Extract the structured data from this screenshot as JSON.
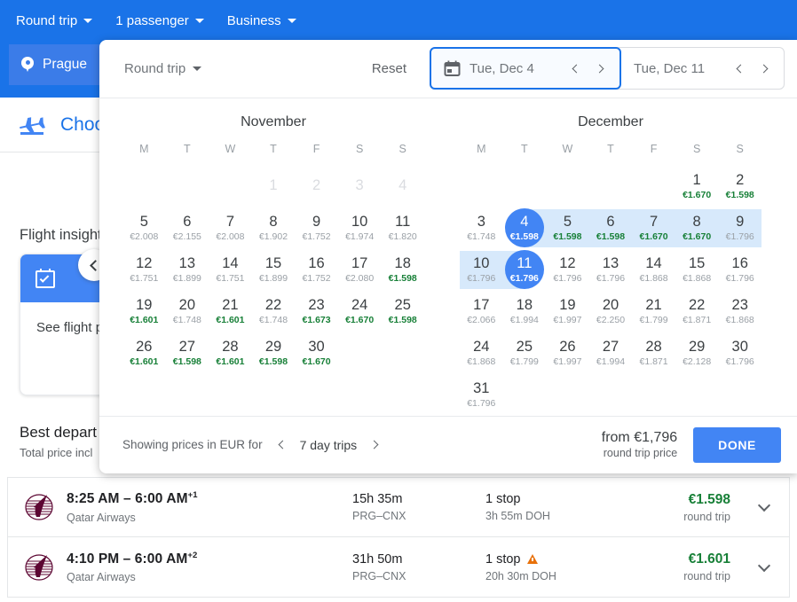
{
  "topbar": {
    "controls": [
      {
        "label": "Round trip",
        "name": "trip-type-dropdown"
      },
      {
        "label": "1 passenger",
        "name": "passengers-dropdown"
      },
      {
        "label": "Business",
        "name": "cabin-class-dropdown"
      }
    ],
    "origin": "Prague"
  },
  "background": {
    "choose_label": "Choose",
    "insights_title": "Flight insights",
    "insight_card_text": "See flight pri",
    "insight_link": "S",
    "best_title": "Best depart",
    "best_subtitle": "Total price incl"
  },
  "dialog": {
    "trip_type": "Round trip",
    "reset_label": "Reset",
    "departure": {
      "value": "Tue, Dec 4"
    },
    "return": {
      "value": "Tue, Dec 11"
    },
    "footer": {
      "showing_prices": "Showing prices in EUR for",
      "trip_length": "7 day trips",
      "from_price": "from €1,796",
      "from_price_sub": "round trip price",
      "done_label": "DONE"
    },
    "dow": [
      "M",
      "T",
      "W",
      "T",
      "F",
      "S",
      "S"
    ],
    "months": [
      {
        "name": "November",
        "lead_blanks": 3,
        "days": [
          {
            "d": 1,
            "price": "",
            "state": "disabled"
          },
          {
            "d": 2,
            "price": "",
            "state": "disabled"
          },
          {
            "d": 3,
            "price": "",
            "state": "disabled"
          },
          {
            "d": 4,
            "price": "",
            "state": "disabled"
          },
          {
            "d": 5,
            "price": "€2.008",
            "state": ""
          },
          {
            "d": 6,
            "price": "€2.155",
            "state": ""
          },
          {
            "d": 7,
            "price": "€2.008",
            "state": ""
          },
          {
            "d": 8,
            "price": "€1.902",
            "state": ""
          },
          {
            "d": 9,
            "price": "€1.752",
            "state": ""
          },
          {
            "d": 10,
            "price": "€1.974",
            "state": ""
          },
          {
            "d": 11,
            "price": "€1.820",
            "state": ""
          },
          {
            "d": 12,
            "price": "€1.751",
            "state": ""
          },
          {
            "d": 13,
            "price": "€1.899",
            "state": ""
          },
          {
            "d": 14,
            "price": "€1.751",
            "state": ""
          },
          {
            "d": 15,
            "price": "€1.899",
            "state": ""
          },
          {
            "d": 16,
            "price": "€1.752",
            "state": ""
          },
          {
            "d": 17,
            "price": "€2.080",
            "state": ""
          },
          {
            "d": 18,
            "price": "€1.598",
            "state": "cheap"
          },
          {
            "d": 19,
            "price": "€1.601",
            "state": "cheap"
          },
          {
            "d": 20,
            "price": "€1.748",
            "state": ""
          },
          {
            "d": 21,
            "price": "€1.601",
            "state": "cheap"
          },
          {
            "d": 22,
            "price": "€1.748",
            "state": ""
          },
          {
            "d": 23,
            "price": "€1.673",
            "state": "cheap"
          },
          {
            "d": 24,
            "price": "€1.670",
            "state": "cheap"
          },
          {
            "d": 25,
            "price": "€1.598",
            "state": "cheap"
          },
          {
            "d": 26,
            "price": "€1.601",
            "state": "cheap"
          },
          {
            "d": 27,
            "price": "€1.598",
            "state": "cheap"
          },
          {
            "d": 28,
            "price": "€1.601",
            "state": "cheap"
          },
          {
            "d": 29,
            "price": "€1.598",
            "state": "cheap"
          },
          {
            "d": 30,
            "price": "€1.670",
            "state": "cheap"
          }
        ]
      },
      {
        "name": "December",
        "lead_blanks": 5,
        "days": [
          {
            "d": 1,
            "price": "€1.670",
            "state": "cheap"
          },
          {
            "d": 2,
            "price": "€1.598",
            "state": "cheap"
          },
          {
            "d": 3,
            "price": "€1.748",
            "state": ""
          },
          {
            "d": 4,
            "price": "€1.598",
            "state": "selected range-start"
          },
          {
            "d": 5,
            "price": "€1.598",
            "state": "cheap inrange"
          },
          {
            "d": 6,
            "price": "€1.598",
            "state": "cheap inrange"
          },
          {
            "d": 7,
            "price": "€1.670",
            "state": "cheap inrange"
          },
          {
            "d": 8,
            "price": "€1.670",
            "state": "cheap inrange"
          },
          {
            "d": 9,
            "price": "€1.796",
            "state": "inrange"
          },
          {
            "d": 10,
            "price": "€1.796",
            "state": "inrange"
          },
          {
            "d": 11,
            "price": "€1.796",
            "state": "selected range-end"
          },
          {
            "d": 12,
            "price": "€1.796",
            "state": ""
          },
          {
            "d": 13,
            "price": "€1.796",
            "state": ""
          },
          {
            "d": 14,
            "price": "€1.868",
            "state": ""
          },
          {
            "d": 15,
            "price": "€1.868",
            "state": ""
          },
          {
            "d": 16,
            "price": "€1.796",
            "state": ""
          },
          {
            "d": 17,
            "price": "€2.066",
            "state": ""
          },
          {
            "d": 18,
            "price": "€1.994",
            "state": ""
          },
          {
            "d": 19,
            "price": "€1.997",
            "state": ""
          },
          {
            "d": 20,
            "price": "€2.250",
            "state": ""
          },
          {
            "d": 21,
            "price": "€1.799",
            "state": ""
          },
          {
            "d": 22,
            "price": "€1.871",
            "state": ""
          },
          {
            "d": 23,
            "price": "€1.868",
            "state": ""
          },
          {
            "d": 24,
            "price": "€1.868",
            "state": ""
          },
          {
            "d": 25,
            "price": "€1.799",
            "state": ""
          },
          {
            "d": 26,
            "price": "€1.997",
            "state": ""
          },
          {
            "d": 27,
            "price": "€1.994",
            "state": ""
          },
          {
            "d": 28,
            "price": "€1.871",
            "state": ""
          },
          {
            "d": 29,
            "price": "€2.128",
            "state": ""
          },
          {
            "d": 30,
            "price": "€1.796",
            "state": ""
          },
          {
            "d": 31,
            "price": "€1.796",
            "state": ""
          }
        ]
      }
    ]
  },
  "flights": [
    {
      "airline": "Qatar Airways",
      "times": "8:25 AM – 6:00 AM",
      "day_offset": "+1",
      "duration": "15h 35m",
      "route": "PRG–CNX",
      "stops": "1 stop",
      "layover": "3h 55m DOH",
      "warning": false,
      "price": "€1.598",
      "price_sub": "round trip"
    },
    {
      "airline": "Qatar Airways",
      "times": "4:10 PM – 6:00 AM",
      "day_offset": "+2",
      "duration": "31h 50m",
      "route": "PRG–CNX",
      "stops": "1 stop",
      "layover": "20h 30m DOH",
      "warning": true,
      "price": "€1.601",
      "price_sub": "round trip"
    }
  ],
  "colors": {
    "brand_blue": "#1a73e8",
    "selected_blue": "#4285f4",
    "range_band": "#d7e9fb",
    "cheap_green": "#188038",
    "warning_orange": "#e8710a",
    "qatar_maroon": "#5c0632"
  }
}
